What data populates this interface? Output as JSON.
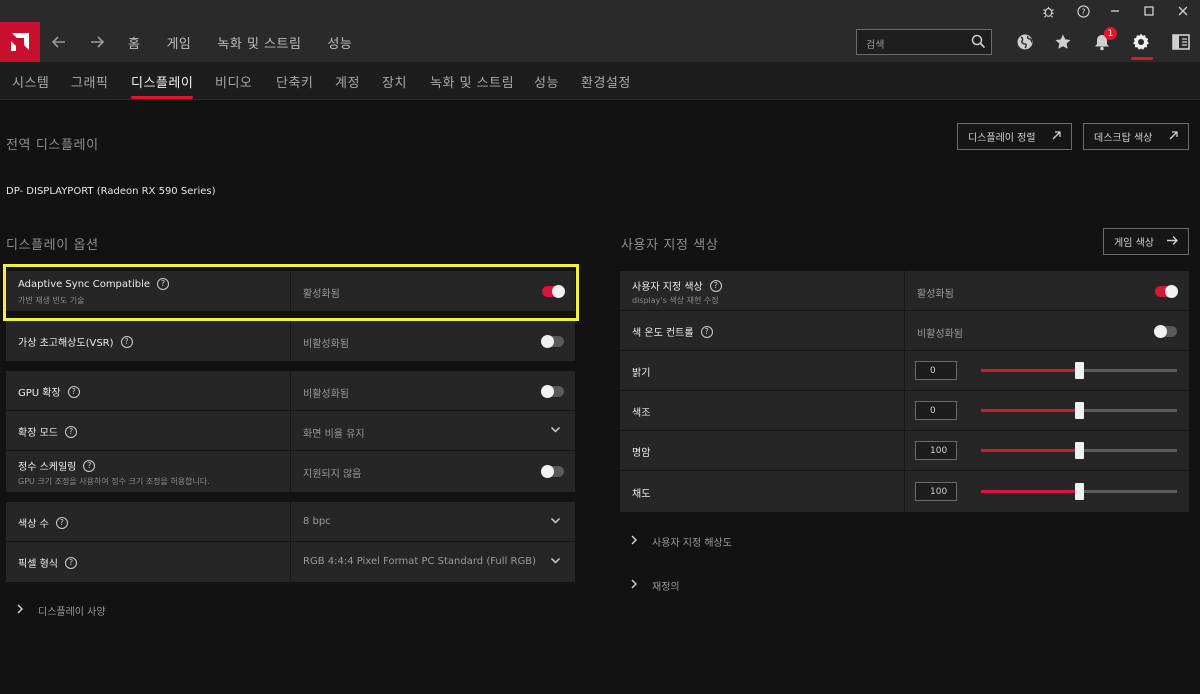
{
  "header": {
    "nav": [
      "홈",
      "게임",
      "녹화 및 스트림",
      "성능"
    ],
    "search_placeholder": "검색",
    "notification_count": "1"
  },
  "subnav": {
    "tabs": [
      "시스템",
      "그래픽",
      "디스플레이",
      "비디오",
      "단축키",
      "계정",
      "장치",
      "녹화 및 스트림",
      "성능",
      "환경설정"
    ],
    "active": "디스플레이"
  },
  "main": {
    "global_display_heading": "전역 디스플레이",
    "display_align_button": "디스플레이 정렬",
    "desktop_color_button": "데스크탑 색상",
    "device_name": "DP- DISPLAYPORT (Radeon RX 590 Series)",
    "display_options_heading": "디스플레이 옵션",
    "custom_color_heading": "사용자 지정 색상",
    "game_color_button": "게임 색상",
    "help_glyph": "?"
  },
  "display_options": {
    "adaptive_sync": {
      "label": "Adaptive Sync Compatible",
      "sub": "가변 재생 빈도 기술",
      "value": "활성화됨",
      "enabled": true
    },
    "vsr": {
      "label": "가상 초고해상도(VSR)",
      "value": "비활성화됨",
      "enabled": false
    },
    "gpu_scaling": {
      "label": "GPU 확장",
      "value": "비활성화됨",
      "enabled": false
    },
    "scaling_mode": {
      "label": "확장 모드",
      "value": "화면 비율 유지"
    },
    "integer_scaling": {
      "label": "정수 스케일링",
      "sub": "GPU 크기 조정을 사용하여 정수 크기 조정을 허용합니다.",
      "value": "지원되지 않음",
      "enabled": false
    },
    "color_depth": {
      "label": "색상 수",
      "value": "8 bpc"
    },
    "pixel_format": {
      "label": "픽셀 형식",
      "value": "RGB 4:4:4 Pixel Format PC Standard (Full RGB)"
    },
    "display_specs": "디스플레이 사양"
  },
  "custom_color": {
    "custom_color": {
      "label": "사용자 지정 색상",
      "sub": "display's 색상 재현 수정",
      "value": "활성화됨",
      "enabled": true
    },
    "color_temp": {
      "label": "색 온도 컨트롤",
      "value": "비활성화됨",
      "enabled": false
    },
    "sliders": [
      {
        "label": "밝기",
        "value": "0",
        "fraction": 0.5
      },
      {
        "label": "색조",
        "value": "0",
        "fraction": 0.5
      },
      {
        "label": "명암",
        "value": "100",
        "fraction": 0.5
      },
      {
        "label": "채도",
        "value": "100",
        "fraction": 0.5
      }
    ],
    "custom_resolution": "사용자 지정 해상도",
    "override": "재정의"
  },
  "colors": {
    "accent": "#e3152e",
    "highlight": "#f2f23a",
    "panel": "#262627"
  }
}
